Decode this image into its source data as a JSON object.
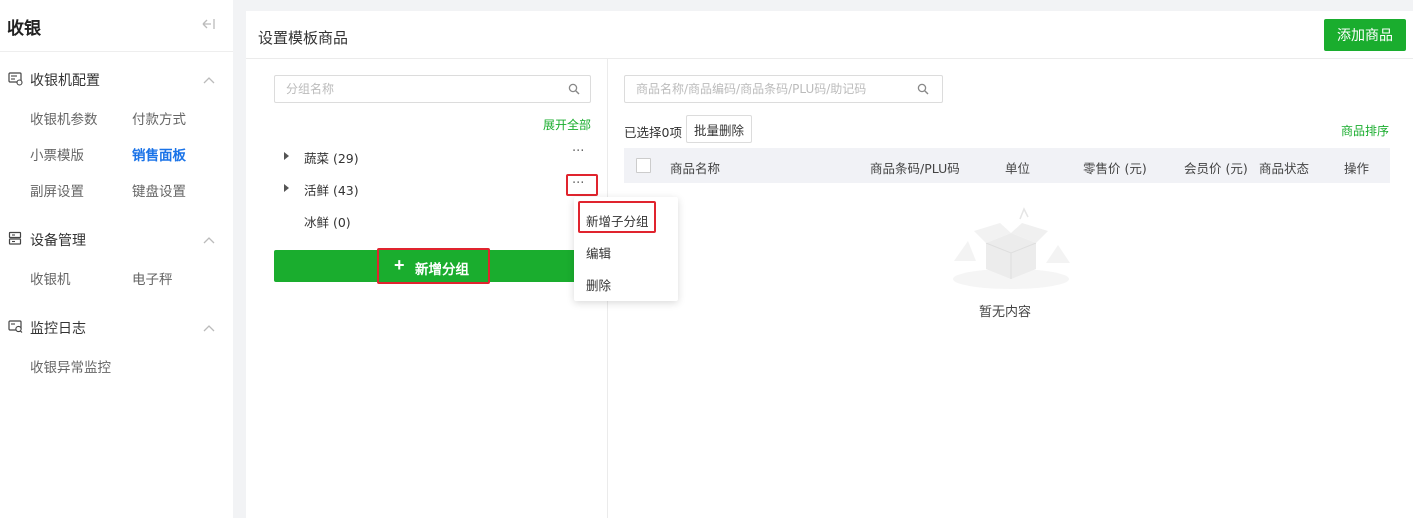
{
  "sidebar": {
    "title": "收银",
    "sections": [
      {
        "label": "收银机配置",
        "items": [
          "收银机参数",
          "付款方式",
          "小票模版",
          "销售面板",
          "副屏设置",
          "键盘设置"
        ]
      },
      {
        "label": "设备管理",
        "items": [
          "收银机",
          "电子秤"
        ]
      },
      {
        "label": "监控日志",
        "items": [
          "收银异常监控"
        ]
      }
    ],
    "active_item": "销售面板"
  },
  "main": {
    "title": "设置模板商品",
    "add_product_label": "添加商品"
  },
  "groups": {
    "search_placeholder": "分组名称",
    "expand_all": "展开全部",
    "items": [
      {
        "label": "蔬菜 (29)",
        "has_children": true
      },
      {
        "label": "活鲜 (43)",
        "has_children": true
      },
      {
        "label": "冰鲜 (0)",
        "has_children": false
      }
    ],
    "more_label": "···",
    "new_group_label": "新增分组",
    "context_menu": [
      "新增子分组",
      "编辑",
      "删除"
    ]
  },
  "products": {
    "search_placeholder": "商品名称/商品编码/商品条码/PLU码/助记码",
    "selected_info": "已选择0项",
    "batch_delete_label": "批量删除",
    "sort_label": "商品排序",
    "columns": [
      "商品名称",
      "商品条码/PLU码",
      "单位",
      "零售价 (元)",
      "会员价 (元)",
      "商品状态",
      "操作"
    ],
    "empty_text": "暂无内容"
  },
  "colors": {
    "accent_green": "#1aad2e",
    "active_blue": "#1a73e8",
    "highlight_red": "#e0242e"
  }
}
